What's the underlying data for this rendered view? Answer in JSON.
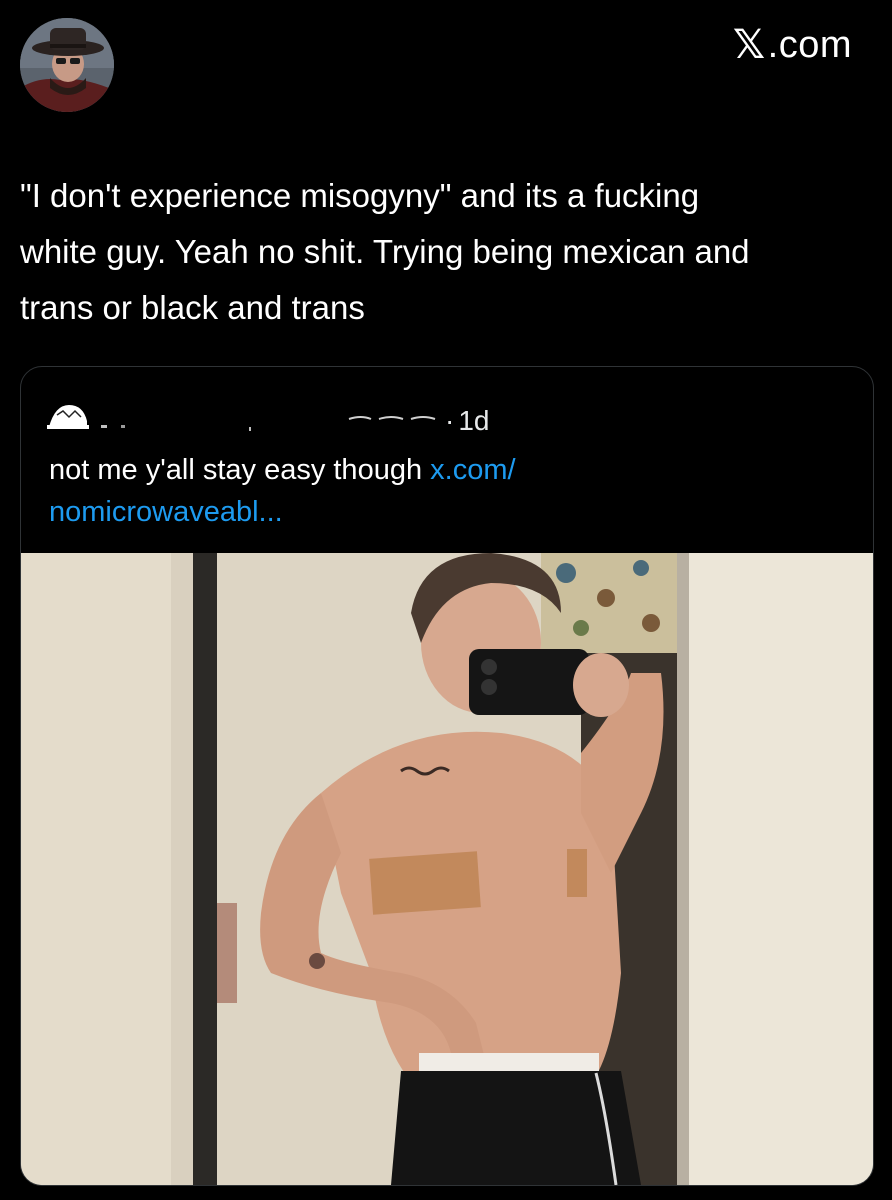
{
  "header": {
    "brand_label": ".com",
    "brand_logo": "𝕏"
  },
  "tweet": {
    "text": "\"I don't experience misogyny\" and its a fucking\nwhite guy. Yeah no shit. Trying being mexican and\ntrans or black and trans"
  },
  "quote": {
    "separator": "·",
    "time": "1d",
    "text": "not me y'all stay easy though ",
    "link_text": "x.com/\nnomicrowaveabl..."
  },
  "colors": {
    "background": "#000000",
    "text": "#ffffff",
    "link": "#1d9bf0",
    "border": "#2f3336"
  },
  "icons": {
    "profile": "avatar",
    "brand": "x-logo-icon",
    "media": "mirror-selfie-photo"
  }
}
